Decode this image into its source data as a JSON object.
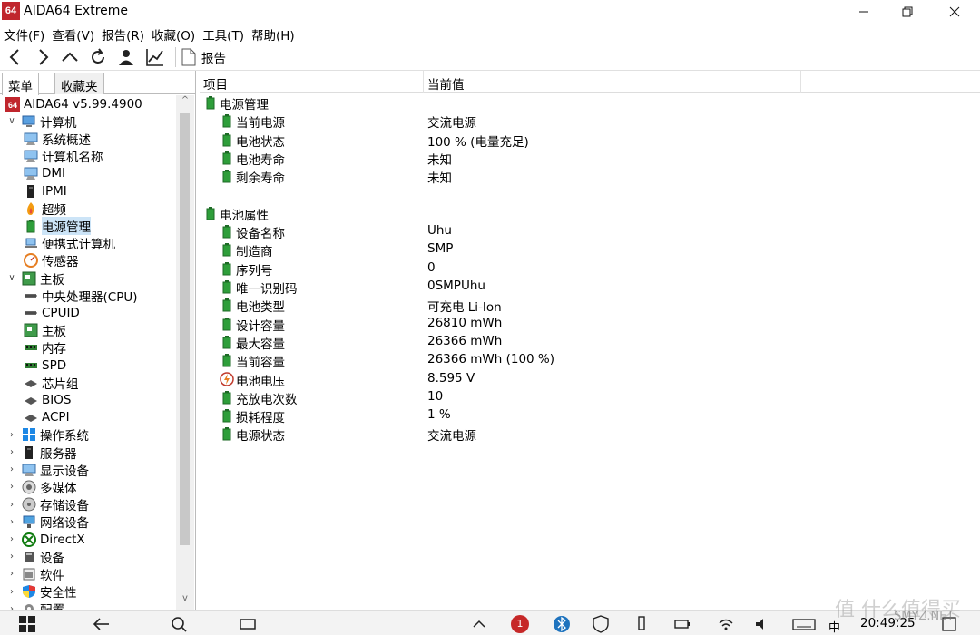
{
  "window": {
    "logo": "64",
    "title": "AIDA64 Extreme"
  },
  "menu": [
    "文件(F)",
    "查看(V)",
    "报告(R)",
    "收藏(O)",
    "工具(T)",
    "帮助(H)"
  ],
  "toolbar": {
    "report_label": "报告"
  },
  "tabs": [
    "菜单",
    "收藏夹"
  ],
  "tree": [
    {
      "label": "AIDA64 v5.99.4900",
      "level": 0,
      "toggle": "",
      "icon": "aida-icon"
    },
    {
      "label": "计算机",
      "level": 1,
      "toggle": "v",
      "icon": "computer-icon"
    },
    {
      "label": "系统概述",
      "level": 2,
      "toggle": "",
      "icon": "monitor-icon"
    },
    {
      "label": "计算机名称",
      "level": 2,
      "toggle": "",
      "icon": "monitor-icon"
    },
    {
      "label": "DMI",
      "level": 2,
      "toggle": "",
      "icon": "monitor-icon"
    },
    {
      "label": "IPMI",
      "level": 2,
      "toggle": "",
      "icon": "server-icon"
    },
    {
      "label": "超频",
      "level": 2,
      "toggle": "",
      "icon": "flame-icon"
    },
    {
      "label": "电源管理",
      "level": 2,
      "toggle": "",
      "icon": "battery-icon",
      "selected": true
    },
    {
      "label": "便携式计算机",
      "level": 2,
      "toggle": "",
      "icon": "laptop-icon"
    },
    {
      "label": "传感器",
      "level": 2,
      "toggle": "",
      "icon": "gauge-icon"
    },
    {
      "label": "主板",
      "level": 1,
      "toggle": "v",
      "icon": "board-icon"
    },
    {
      "label": "中央处理器(CPU)",
      "level": 2,
      "toggle": "",
      "icon": "chip-icon"
    },
    {
      "label": "CPUID",
      "level": 2,
      "toggle": "",
      "icon": "chip-icon"
    },
    {
      "label": "主板",
      "level": 2,
      "toggle": "",
      "icon": "board-icon"
    },
    {
      "label": "内存",
      "level": 2,
      "toggle": "",
      "icon": "ram-icon"
    },
    {
      "label": "SPD",
      "level": 2,
      "toggle": "",
      "icon": "ram-icon"
    },
    {
      "label": "芯片组",
      "level": 2,
      "toggle": "",
      "icon": "chipset-icon"
    },
    {
      "label": "BIOS",
      "level": 2,
      "toggle": "",
      "icon": "chipset-icon"
    },
    {
      "label": "ACPI",
      "level": 2,
      "toggle": "",
      "icon": "chipset-icon"
    },
    {
      "label": "操作系统",
      "level": 1,
      "toggle": ">",
      "icon": "windows-icon"
    },
    {
      "label": "服务器",
      "level": 1,
      "toggle": ">",
      "icon": "server-icon"
    },
    {
      "label": "显示设备",
      "level": 1,
      "toggle": ">",
      "icon": "monitor-icon"
    },
    {
      "label": "多媒体",
      "level": 1,
      "toggle": ">",
      "icon": "speaker-icon"
    },
    {
      "label": "存储设备",
      "level": 1,
      "toggle": ">",
      "icon": "disk-icon"
    },
    {
      "label": "网络设备",
      "level": 1,
      "toggle": ">",
      "icon": "network-icon"
    },
    {
      "label": "DirectX",
      "level": 1,
      "toggle": ">",
      "icon": "xbox-icon"
    },
    {
      "label": "设备",
      "level": 1,
      "toggle": ">",
      "icon": "device-icon"
    },
    {
      "label": "软件",
      "level": 1,
      "toggle": ">",
      "icon": "software-icon"
    },
    {
      "label": "安全性",
      "level": 1,
      "toggle": ">",
      "icon": "shield-icon"
    },
    {
      "label": "配置",
      "level": 1,
      "toggle": ">",
      "icon": "config-icon"
    }
  ],
  "columns": {
    "item": "项目",
    "value": "当前值"
  },
  "sections": [
    {
      "title": "电源管理",
      "rows": [
        {
          "name": "当前电源",
          "value": "交流电源",
          "icon": "battery-icon"
        },
        {
          "name": "电池状态",
          "value": "100 % (电量充足)",
          "icon": "battery-icon"
        },
        {
          "name": "电池寿命",
          "value": "未知",
          "icon": "battery-icon"
        },
        {
          "name": "剩余寿命",
          "value": "未知",
          "icon": "battery-icon"
        }
      ]
    },
    {
      "title": "电池属性",
      "rows": [
        {
          "name": "设备名称",
          "value": "Uhu",
          "icon": "battery-icon"
        },
        {
          "name": "制造商",
          "value": "SMP",
          "icon": "battery-icon"
        },
        {
          "name": "序列号",
          "value": "0",
          "icon": "battery-icon"
        },
        {
          "name": "唯一识别码",
          "value": "0SMPUhu",
          "icon": "battery-icon"
        },
        {
          "name": "电池类型",
          "value": "可充电 Li-Ion",
          "icon": "battery-icon"
        },
        {
          "name": "设计容量",
          "value": "26810 mWh",
          "icon": "battery-icon"
        },
        {
          "name": "最大容量",
          "value": "26366 mWh",
          "icon": "battery-icon"
        },
        {
          "name": "当前容量",
          "value": "26366 mWh  (100 %)",
          "icon": "battery-icon"
        },
        {
          "name": "电池电压",
          "value": "8.595 V",
          "icon": "voltage-icon"
        },
        {
          "name": "充放电次数",
          "value": "10",
          "icon": "battery-icon"
        },
        {
          "name": "损耗程度",
          "value": "1 %",
          "icon": "battery-icon"
        },
        {
          "name": "电源状态",
          "value": "交流电源",
          "icon": "battery-icon"
        }
      ]
    }
  ],
  "taskbar": {
    "ime": "中",
    "clock": "20:49:25",
    "badge": "1"
  },
  "watermark": {
    "text": "值 什么值得买",
    "sub": "SMYZ.NET"
  }
}
